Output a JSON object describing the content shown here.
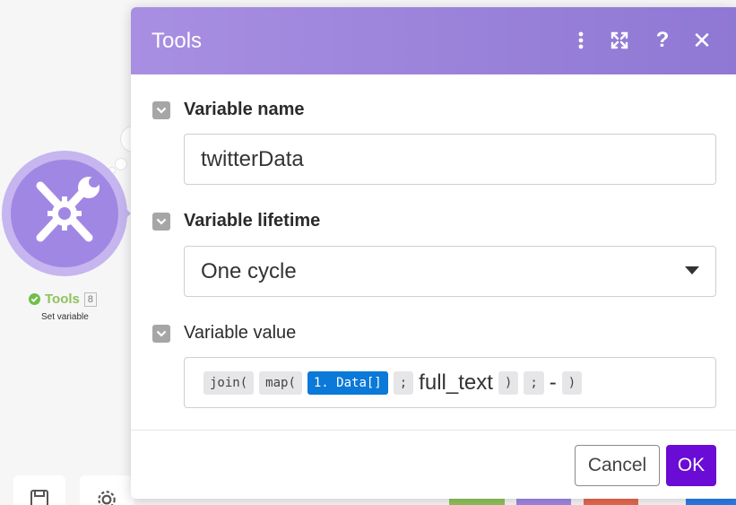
{
  "module": {
    "name": "Tools",
    "count": "8",
    "subtitle": "Set variable",
    "colors": {
      "ring": "#c6b5ef",
      "fill": "#a087e4",
      "status": "#6fbf4a"
    }
  },
  "dialog": {
    "title": "Tools",
    "header_icons": [
      "more-vertical-icon",
      "expand-icon",
      "help-icon",
      "close-icon"
    ],
    "help_glyph": "?",
    "close_glyph": "✕",
    "fields": {
      "name": {
        "label": "Variable name",
        "value": "twitterData"
      },
      "lifetime": {
        "label": "Variable lifetime",
        "value": "One cycle"
      },
      "value": {
        "label": "Variable value",
        "tokens": [
          "join(",
          "map(",
          "1. Data[]",
          ";",
          "full_text",
          ")",
          ";",
          "-",
          ")"
        ]
      }
    },
    "footer": {
      "cancel": "Cancel",
      "ok": "OK"
    },
    "colors": {
      "header": "#9a82dc",
      "ok_button": "#6b0bd6",
      "item_pill": "#0a79d8"
    }
  }
}
